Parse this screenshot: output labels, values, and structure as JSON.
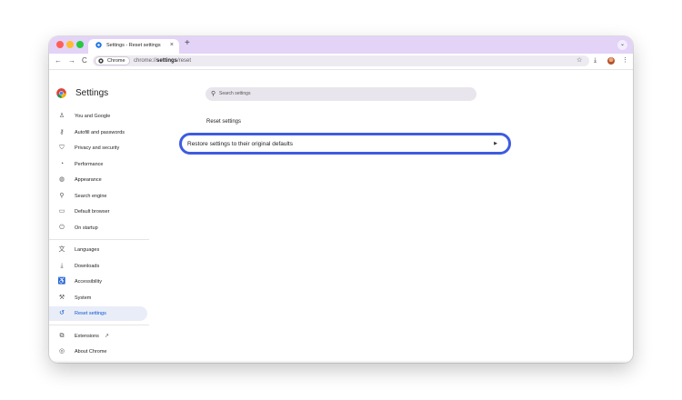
{
  "browser": {
    "tab_title": "Settings - Reset settings",
    "tab_close": "×",
    "new_tab": "+",
    "tab_menu": "⌄",
    "back": "←",
    "forward": "→",
    "reload": "C",
    "chip_label": "Chrome",
    "url_scheme": "chrome://",
    "url_host": "settings",
    "url_path": "/reset",
    "bookmark_icon": "☆",
    "download_icon": "⤓",
    "menu_icon": "⋮"
  },
  "header": {
    "title": "Settings"
  },
  "search": {
    "icon": "⚲",
    "placeholder": "Search settings"
  },
  "sidebar": {
    "items": [
      {
        "label": "You and Google",
        "icon": "person-icon",
        "glyph": "♙"
      },
      {
        "label": "Autofill and passwords",
        "icon": "key-icon",
        "glyph": "⚷"
      },
      {
        "label": "Privacy and security",
        "icon": "shield-icon",
        "glyph": "⛉"
      },
      {
        "label": "Performance",
        "icon": "speedometer-icon",
        "glyph": "◔"
      },
      {
        "label": "Appearance",
        "icon": "palette-icon",
        "glyph": "◍"
      },
      {
        "label": "Search engine",
        "icon": "search-icon",
        "glyph": "⚲"
      },
      {
        "label": "Default browser",
        "icon": "browser-icon",
        "glyph": "▭"
      },
      {
        "label": "On startup",
        "icon": "power-icon",
        "glyph": "⏻"
      },
      {
        "label": "Languages",
        "icon": "translate-icon",
        "glyph": "文"
      },
      {
        "label": "Downloads",
        "icon": "download-icon",
        "glyph": "⤓"
      },
      {
        "label": "Accessibility",
        "icon": "accessibility-icon",
        "glyph": "♿"
      },
      {
        "label": "System",
        "icon": "wrench-icon",
        "glyph": "⚒"
      },
      {
        "label": "Reset settings",
        "icon": "reset-icon",
        "glyph": "↺",
        "active": true
      },
      {
        "label": "Extensions",
        "icon": "puzzle-icon",
        "glyph": "⧉"
      },
      {
        "label": "About Chrome",
        "icon": "chrome-icon",
        "glyph": "◎"
      }
    ],
    "external_link_glyph": "↗"
  },
  "main": {
    "section_title": "Reset settings",
    "restore_label": "Restore settings to their original defaults",
    "restore_arrow": "▶"
  },
  "colors": {
    "tabstrip": "#e3d3f7",
    "accent_ring": "#3f5be0",
    "active_item_bg": "#e9edf8",
    "active_item_text": "#0b57d0"
  }
}
